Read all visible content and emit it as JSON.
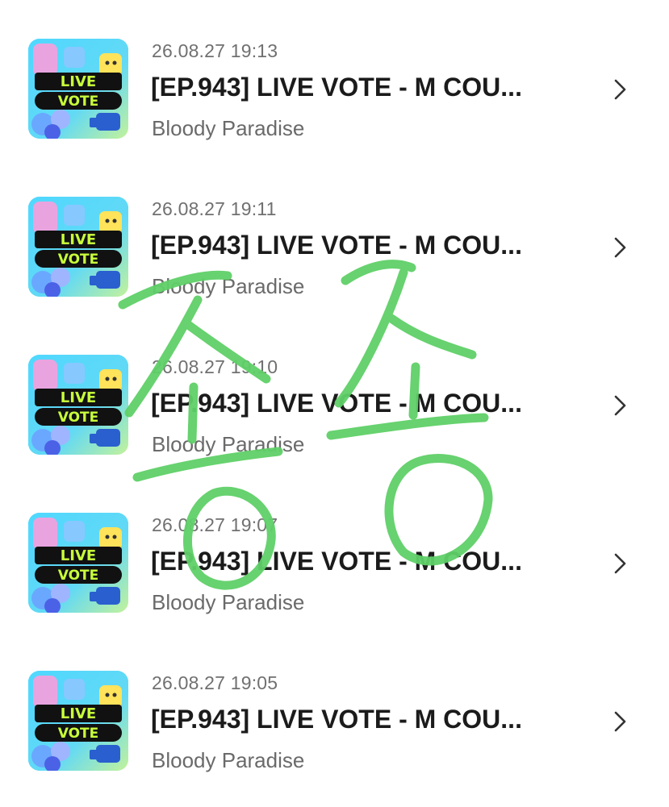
{
  "items": [
    {
      "timestamp": "26.08.27 19:13",
      "title": "[EP.943] LIVE VOTE - M COU...",
      "channel": "Bloody Paradise",
      "thumb_label_1": "LIVE",
      "thumb_label_2": "VOTE"
    },
    {
      "timestamp": "26.08.27 19:11",
      "title": "[EP.943] LIVE VOTE - M COU...",
      "channel": "Bloody Paradise",
      "thumb_label_1": "LIVE",
      "thumb_label_2": "VOTE"
    },
    {
      "timestamp": "26.08.27 19:10",
      "title": "[EP.943] LIVE VOTE - M COU...",
      "channel": "Bloody Paradise",
      "thumb_label_1": "LIVE",
      "thumb_label_2": "VOTE"
    },
    {
      "timestamp": "26.08.27 19:07",
      "title": "[EP.943] LIVE VOTE - M COU...",
      "channel": "Bloody Paradise",
      "thumb_label_1": "LIVE",
      "thumb_label_2": "VOTE"
    },
    {
      "timestamp": "26.08.27 19:05",
      "title": "[EP.943] LIVE VOTE - M COU...",
      "channel": "Bloody Paradise",
      "thumb_label_1": "LIVE",
      "thumb_label_2": "VOTE"
    }
  ],
  "icons": {
    "row_chevron": "chevron-right-icon"
  },
  "overlay": {
    "handwritten_text": "소송",
    "color": "#5fd068"
  },
  "colors": {
    "title": "#1b1b1b",
    "meta": "#707070",
    "thumb_label_bg": "#111111",
    "thumb_label_text": "#c8ff3a"
  }
}
